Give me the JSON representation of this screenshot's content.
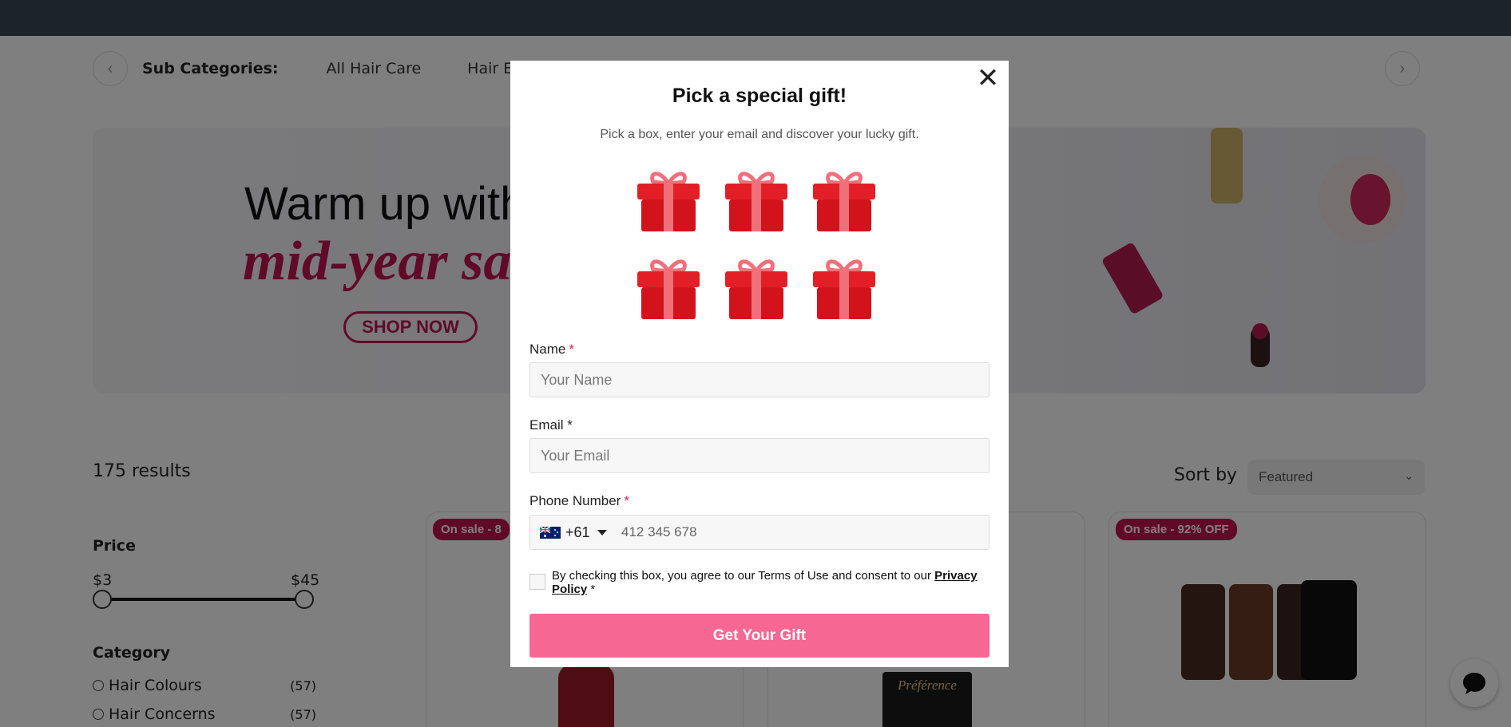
{
  "subcategories": {
    "title": "Sub Categories:",
    "items": [
      "All Hair Care",
      "Hair Es"
    ]
  },
  "banner": {
    "line1": "Warm up with",
    "line2": "mid-year sa",
    "cta": "SHOP NOW"
  },
  "results": {
    "count_text": "175 results",
    "sort_label": "Sort by",
    "sort_value": "Featured"
  },
  "filters": {
    "price_title": "Price",
    "price_min": "$3",
    "price_max": "$45",
    "category_title": "Category",
    "categories": [
      {
        "label": "Hair Colours",
        "count": "(57)"
      },
      {
        "label": "Hair Concerns",
        "count": "(57)"
      }
    ]
  },
  "products": [
    {
      "badge": "On sale - 8"
    },
    {
      "badge": ""
    },
    {
      "badge": "On sale - 92% OFF"
    }
  ],
  "modal": {
    "title": "Pick a special gift!",
    "subtitle": "Pick a box, enter your email and discover your lucky gift.",
    "close_glyph": "✕",
    "name_label": "Name",
    "name_req": "*",
    "name_placeholder": "Your Name",
    "email_label": "Email *",
    "email_placeholder": "Your Email",
    "phone_label": "Phone Number",
    "phone_req": "*",
    "country_code": "+61",
    "phone_placeholder": "412 345 678",
    "consent_text": "By checking this box, you agree to our Terms of Use and consent to our ",
    "privacy_link": "Privacy Policy",
    "consent_req": " *",
    "submit_label": "Get Your Gift"
  },
  "icons": {
    "gift": "gift-icon",
    "close": "close-icon",
    "chat": "chat-icon",
    "flag": "australia-flag-icon"
  },
  "colors": {
    "accent": "#f76794",
    "brand": "#c0154f",
    "gift_red": "#d31a22"
  }
}
